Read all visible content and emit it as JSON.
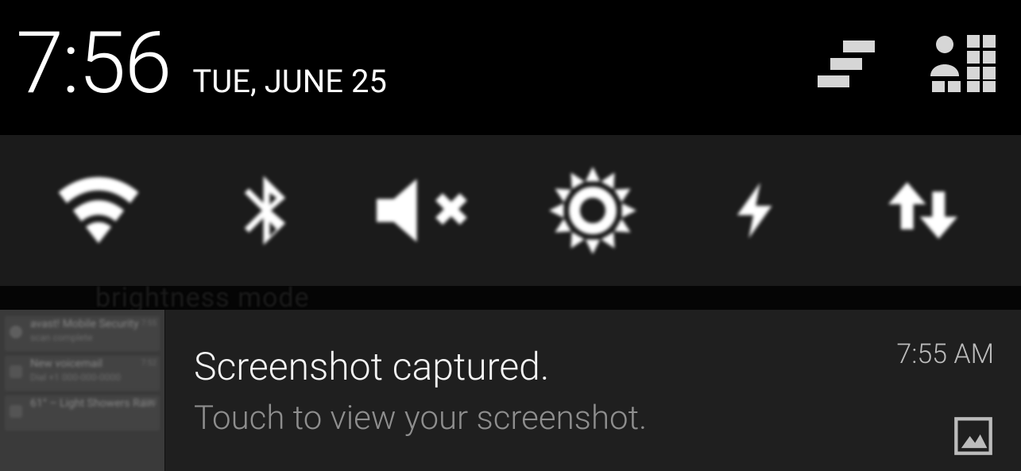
{
  "header": {
    "time": "7:56",
    "date": "TUE, JUNE 25"
  },
  "toggles": {
    "wifi": "wifi",
    "bluetooth": "bluetooth",
    "mute": "mute",
    "brightness": "brightness",
    "power": "power-saving",
    "data": "mobile-data"
  },
  "background_hint": "brightness mode",
  "notification": {
    "title": "Screenshot captured.",
    "subtitle": "Touch to view your screenshot.",
    "time": "7:55 AM"
  }
}
